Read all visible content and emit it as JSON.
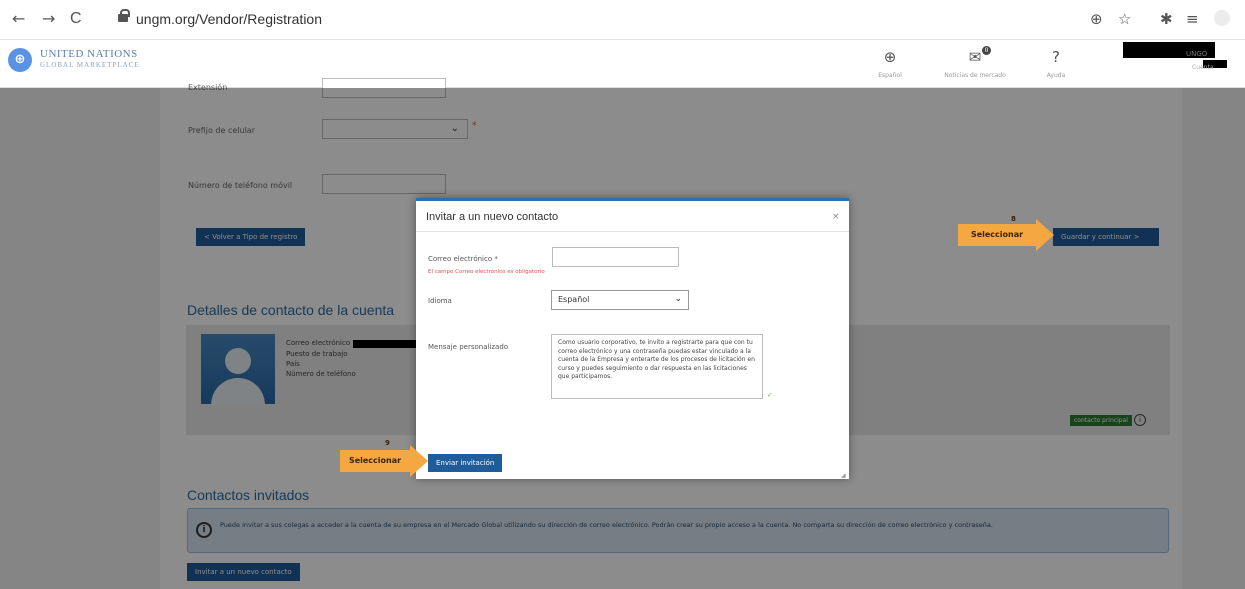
{
  "browser": {
    "back": "←",
    "forward": "→",
    "reload": "C",
    "url": "ungm.org/Vendor/Registration",
    "zoom_icon": "⊕",
    "star_icon": "☆",
    "extensions_icon": "✱",
    "reading_list_icon": "≡"
  },
  "header": {
    "brand_line1": "UNITED NATIONS",
    "brand_line2": "GLOBAL MARKETPLACE",
    "language_label": "Español",
    "market_label": "Noticias de mercado",
    "help_label": "Ayuda",
    "user_name": "UNGO",
    "user_sub": "Cuenta",
    "badge_count": "0"
  },
  "form": {
    "extension_label": "Extensión",
    "cell_prefix_label": "Prefijo de celular",
    "mobile_label": "Número de teléfono móvil",
    "back_button": "< Volver a Tipo de registro",
    "save_button": "Guardar y continuar >"
  },
  "contact_section": {
    "title": "Detalles de contacto de la cuenta",
    "email_label": "Correo electrónico",
    "job_label": "Puesto de trabajo",
    "role_label": "País",
    "phone_label": "Número de teléfono",
    "primary_badge": "contacto principal"
  },
  "invited_section": {
    "title": "Contactos invitados",
    "info_text": "Puede invitar a sus colegas a acceder a la cuenta de su empresa en el Mercado Global utilizando su dirección de correo electrónico. Podrán crear su propio acceso a la cuenta. No comparta su dirección de correo electrónico y contraseña.",
    "invite_button": "Invitar a un nuevo contacto"
  },
  "modal": {
    "title": "Invitar a un nuevo contacto",
    "close": "×",
    "email_label": "Correo electrónico *",
    "email_error": "El campo Correo electrónico es obligatorio",
    "email_value": "",
    "language_label": "Idioma",
    "language_value": "Español",
    "message_label": "Mensaje personalizado",
    "message_value": "Como usuario corporativo, te invito a registrarte para que con tu correo electrónico y una contraseña puedas estar vinculado a la cuenta de la Empresa y enterarte de los procesos de licitación en curso y puedes seguimiento o dar respuesta en las licitaciones que participamos.",
    "send_button": "Enviar invitación"
  },
  "annotations": {
    "step8_num": "8",
    "step8_label": "Seleccionar",
    "step9_num": "9",
    "step9_label": "Seleccionar"
  }
}
